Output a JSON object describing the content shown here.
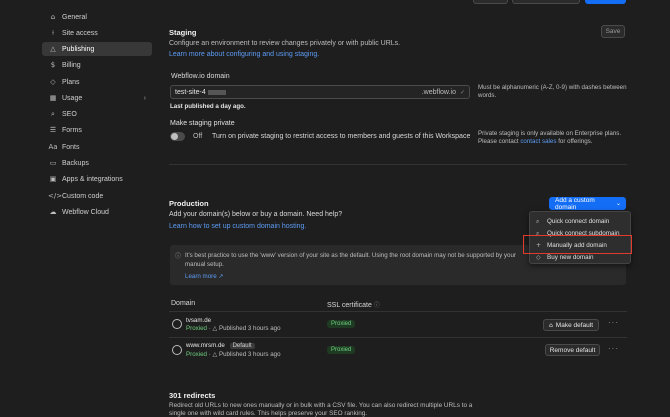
{
  "sidebar": {
    "items": [
      {
        "label": "General",
        "icon": "⌂"
      },
      {
        "label": "Site access",
        "icon": "🔒"
      },
      {
        "label": "Publishing",
        "icon": "△"
      },
      {
        "label": "Billing",
        "icon": "$"
      },
      {
        "label": "Plans",
        "icon": "◇"
      },
      {
        "label": "Usage",
        "icon": "▦"
      },
      {
        "label": "SEO",
        "icon": "⌕"
      },
      {
        "label": "Forms",
        "icon": "☰"
      },
      {
        "label": "Fonts",
        "icon": "Aa"
      },
      {
        "label": "Backups",
        "icon": "▭"
      },
      {
        "label": "Apps & integrations",
        "icon": "▣"
      },
      {
        "label": "Custom code",
        "icon": "</>"
      },
      {
        "label": "Webflow Cloud",
        "icon": "☁"
      }
    ]
  },
  "staging": {
    "title": "Staging",
    "description": "Configure an environment to review changes privately or with public URLs.",
    "learn_link": "Learn more about configuring and using staging.",
    "save_label": "Save",
    "domain_label": "Webflow.io domain",
    "domain_value": "test-site-4",
    "domain_suffix": ".webflow.io",
    "domain_hint": "Must be alphanumeric (A-Z, 0-9) with dashes between words.",
    "last_published": "Last published a day ago.",
    "private_label": "Make staging private",
    "toggle_state": "Off",
    "toggle_text": "Turn on private staging to restrict access to members and guests of this Workspace",
    "enterprise_note": "Private staging is only available on Enterprise plans.",
    "contact_prefix": "Please contact",
    "contact_link": "contact sales",
    "contact_suffix": "for offerings."
  },
  "production": {
    "title": "Production",
    "description": "Add your domain(s) below or buy a domain. Need help?",
    "setup_link": "Learn how to set up custom domain hosting.",
    "add_domain_button": "Add a custom domain",
    "notice_text": "It's best practice to use the 'www' version of your site as the default. Using the root domain may not be supported by your",
    "notice_text2": "manual setup.",
    "notice_link": "Learn more ↗",
    "col_domain": "Domain",
    "col_ssl": "SSL certificate",
    "rows": [
      {
        "domain": "tvsam.de",
        "status": "Proxied",
        "published": "Published 3 hours ago",
        "ssl": "Proxied",
        "action": "Make default",
        "badge": ""
      },
      {
        "domain": "www.mrsm.de",
        "status": "Proxied",
        "published": "Published 3 hours ago",
        "ssl": "Proxied",
        "action": "Remove default",
        "badge": "Default"
      }
    ]
  },
  "dropdown": {
    "items": [
      {
        "label": "Quick connect domain",
        "icon": "⌕"
      },
      {
        "label": "Quick connect subdomain",
        "icon": "⌕"
      },
      {
        "label": "Manually add domain",
        "icon": "+"
      },
      {
        "label": "Buy new domain",
        "icon": "◇"
      }
    ]
  },
  "redirects": {
    "title": "301 redirects",
    "description": "Redirect old URLs to new ones manually or in bulk with a CSV file. You can also redirect multiple URLs to a",
    "description2": "single one with wild card rules. This helps preserve your SEO ranking."
  }
}
